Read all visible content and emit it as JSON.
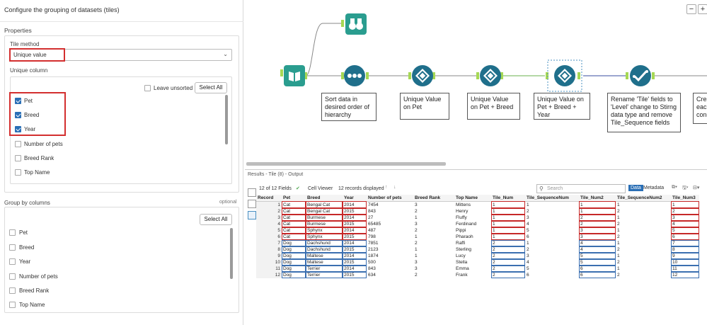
{
  "left_panel": {
    "header": "Configure the grouping of datasets (tiles)",
    "properties_title": "Properties",
    "tile_method_label": "Tile method",
    "tile_method_value": "Unique value",
    "unique_column_label": "Unique column",
    "leave_unsorted_label": "Leave unsorted",
    "select_all_label": "Select All",
    "unique_columns": [
      {
        "label": "Pet",
        "checked": true
      },
      {
        "label": "Breed",
        "checked": true
      },
      {
        "label": "Year",
        "checked": true
      },
      {
        "label": "Number of pets",
        "checked": false
      },
      {
        "label": "Breed Rank",
        "checked": false
      },
      {
        "label": "Top Name",
        "checked": false
      }
    ],
    "group_by_label": "Group by columns",
    "optional_label": "optional",
    "group_select_all_label": "Select All",
    "group_columns": [
      {
        "label": "Pet"
      },
      {
        "label": "Breed"
      },
      {
        "label": "Year"
      },
      {
        "label": "Number of pets"
      },
      {
        "label": "Breed Rank"
      },
      {
        "label": "Top Name"
      }
    ]
  },
  "canvas": {
    "zoom_minus": "−",
    "zoom_plus": "+",
    "captions": {
      "sort": "Sort data in desired order of hierarchy",
      "tile1": "Unique Value on Pet",
      "tile2": "Unique Value on Pet + Breed",
      "tile3": "Unique Value on Pet + Breed + Year",
      "rename": "Rename 'Tile' fields to 'Level' change to Stirng data type and remove Tile_Sequence fields",
      "partial": "Crea each conc"
    },
    "colors": {
      "input": "#2a9d8f",
      "tile": "#1f6f8b",
      "select": "#1f6f8b",
      "browse": "#2a9d8f"
    }
  },
  "results": {
    "title": "Results - Tile (8) - Output",
    "fields_info": "12 of 12 Fields",
    "cell_viewer": "Cell Viewer",
    "records_info": "12 records displayed",
    "search_placeholder": "Search",
    "tab_data": "Data",
    "tab_metadata": "Metadata",
    "columns": [
      "Record",
      "Pet",
      "Breed",
      "Year",
      "Number of pets",
      "Breed Rank",
      "Top Name",
      "Tile_Num",
      "Tile_SequenceNum",
      "Tile_Num2",
      "Tile_SequenceNum2",
      "Tile_Num3"
    ],
    "rows": [
      [
        "1",
        "Cat",
        "Bengal Cat",
        "2014",
        "7454",
        "3",
        "Mittens",
        "1",
        "1",
        "1",
        "1",
        "1"
      ],
      [
        "2",
        "Cat",
        "Bengal Cat",
        "2015",
        "843",
        "2",
        "Henry",
        "1",
        "2",
        "1",
        "2",
        "2"
      ],
      [
        "3",
        "Cat",
        "Burmese",
        "2014",
        "27",
        "1",
        "Fluffy",
        "1",
        "3",
        "2",
        "1",
        "3"
      ],
      [
        "4",
        "Cat",
        "Burmese",
        "2015",
        "65485",
        "3",
        "Ferdinand",
        "1",
        "4",
        "2",
        "2",
        "4"
      ],
      [
        "5",
        "Cat",
        "Sphynx",
        "2014",
        "487",
        "2",
        "Pippi",
        "1",
        "5",
        "3",
        "1",
        "5"
      ],
      [
        "6",
        "Cat",
        "Sphynx",
        "2015",
        "798",
        "1",
        "Pharaoh",
        "1",
        "6",
        "3",
        "2",
        "6"
      ],
      [
        "7",
        "Dog",
        "Dachshund",
        "2014",
        "7851",
        "2",
        "Raffi",
        "2",
        "1",
        "4",
        "1",
        "7"
      ],
      [
        "8",
        "Dog",
        "Dachshund",
        "2015",
        "2123",
        "1",
        "Sterling",
        "2",
        "2",
        "4",
        "2",
        "8"
      ],
      [
        "9",
        "Dog",
        "Maltese",
        "2014",
        "1874",
        "1",
        "Lucy",
        "2",
        "3",
        "5",
        "1",
        "9"
      ],
      [
        "10",
        "Dog",
        "Maltese",
        "2015",
        "500",
        "3",
        "Stella",
        "2",
        "4",
        "5",
        "2",
        "10"
      ],
      [
        "11",
        "Dog",
        "Terrier",
        "2014",
        "843",
        "3",
        "Emma",
        "2",
        "5",
        "6",
        "1",
        "11"
      ],
      [
        "12",
        "Dog",
        "Terrier",
        "2015",
        "634",
        "2",
        "Frank",
        "2",
        "6",
        "6",
        "2",
        "12"
      ]
    ]
  }
}
